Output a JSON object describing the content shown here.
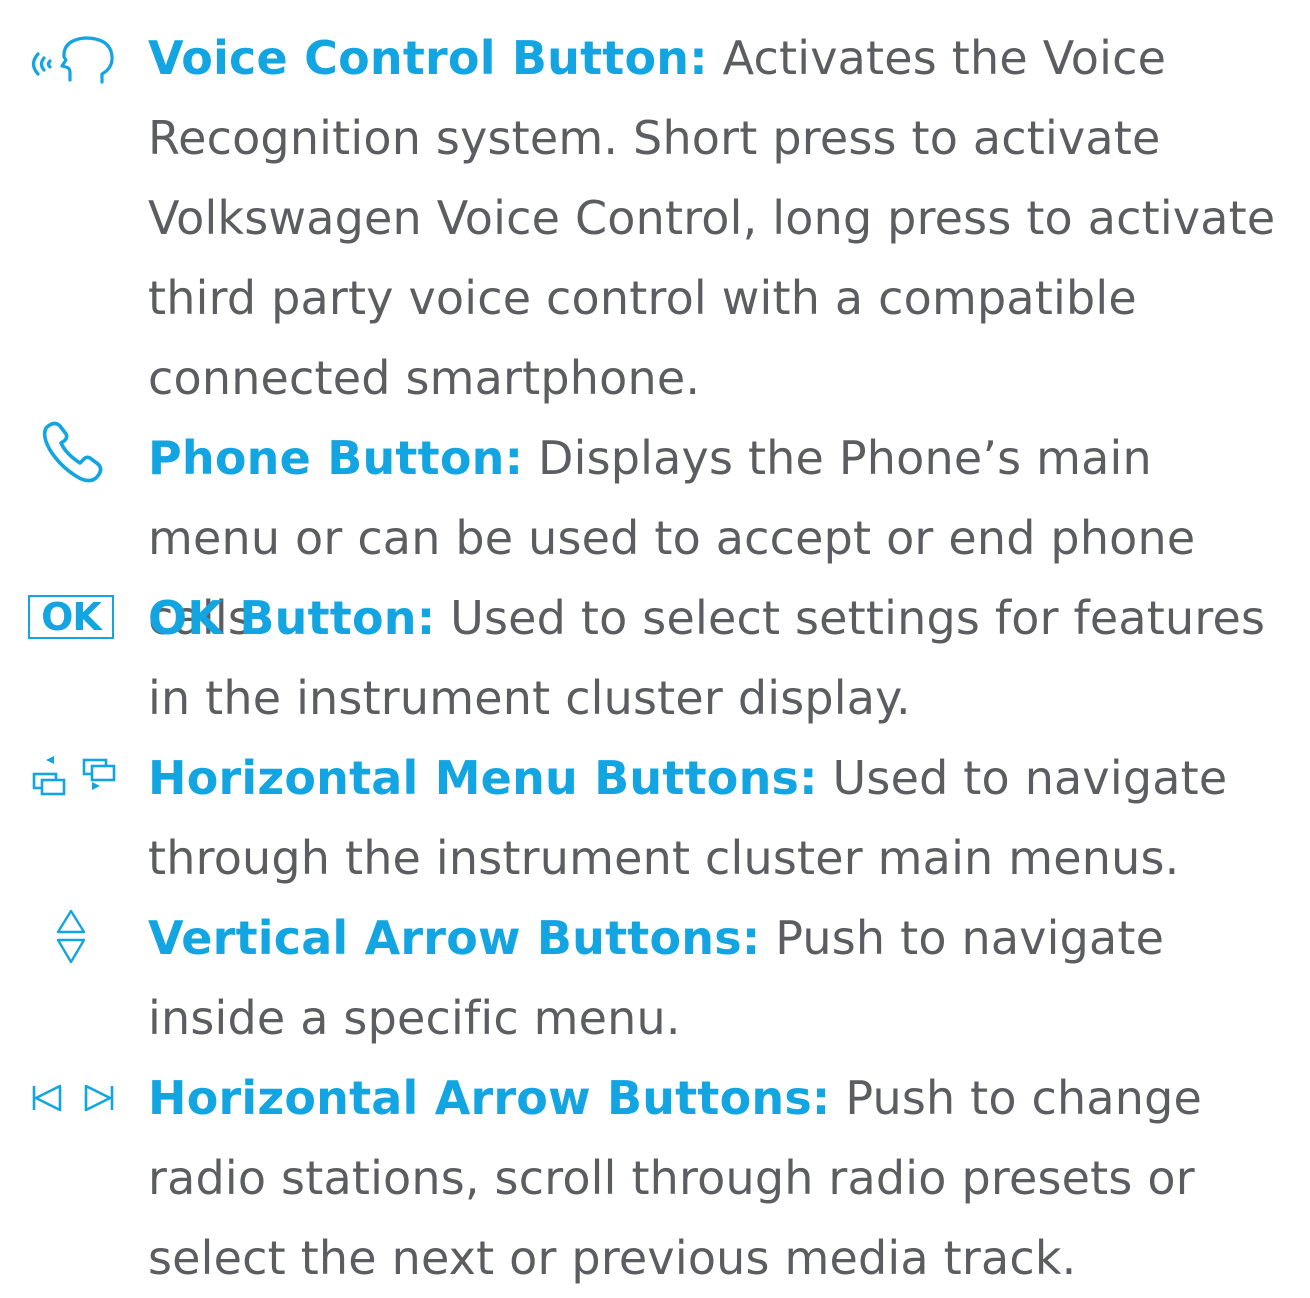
{
  "colors": {
    "accent": "#13a5e1",
    "body_text": "#5b5d60",
    "background": "#ffffff"
  },
  "entries": [
    {
      "icon": "voice-control-icon",
      "term": "Voice Control Button:",
      "description": "Activates the Voice Recognition system. Short press to activate Volkswagen Voice Control, long press to activate third party voice control with a compatible connected smartphone."
    },
    {
      "icon": "phone-icon",
      "term": "Phone Button:",
      "description": "Displays the Phone’s main menu or can be used to accept or end phone calls."
    },
    {
      "icon": "ok-icon",
      "icon_text": "OK",
      "term": "OK Button:",
      "description": "Used to select settings for features in the instrument cluster display."
    },
    {
      "icon": "horizontal-menu-icon",
      "term": "Horizontal Menu Buttons:",
      "description": "Used to navigate through the instrument cluster main menus."
    },
    {
      "icon": "vertical-arrows-icon",
      "term": "Vertical Arrow Buttons:",
      "description": "Push to navigate inside a specific menu."
    },
    {
      "icon": "horizontal-arrows-icon",
      "term": "Horizontal Arrow Buttons:",
      "description": "Push to change radio stations, scroll through radio presets or select the next or previous media track."
    }
  ]
}
